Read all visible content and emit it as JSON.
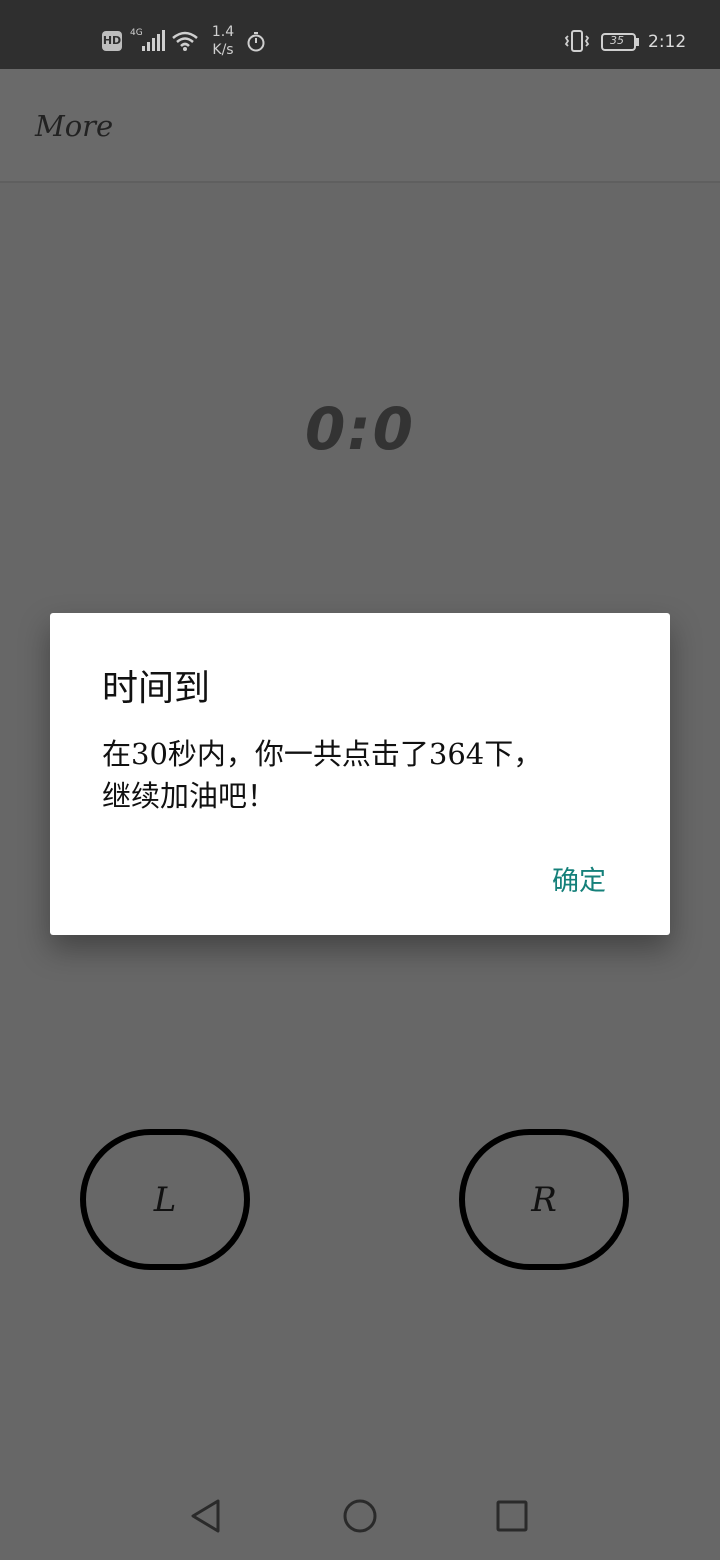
{
  "status_bar": {
    "hd_label": "HD",
    "network_label": "4G",
    "speed_value": "1.4",
    "speed_unit": "K/s",
    "battery_level": "35",
    "time": "2:12",
    "icons": [
      "hd-icon",
      "signal-icon",
      "wifi-icon",
      "timer-icon",
      "vibrate-icon",
      "battery-icon"
    ]
  },
  "app_bar": {
    "menu_label": "More"
  },
  "score": {
    "text": "0:0"
  },
  "buttons": {
    "left_label": "L",
    "right_label": "R"
  },
  "dialog": {
    "title": "时间到",
    "message": "在30秒内，你一共点击了364下，\n继续加油吧！",
    "confirm_label": "确定",
    "accent_color": "#15807a"
  },
  "nav_bar": {
    "icons": [
      "back-icon",
      "home-icon",
      "recents-icon"
    ]
  }
}
